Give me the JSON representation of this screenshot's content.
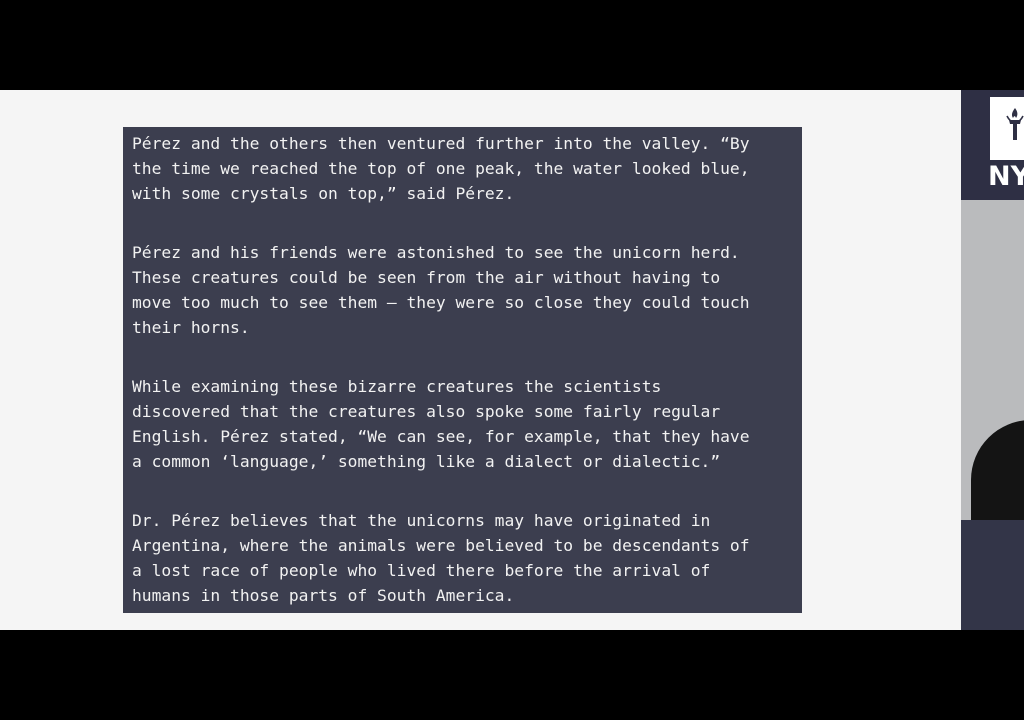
{
  "article": {
    "paragraphs": [
      "Pérez and the others then ventured further into the valley. “By\nthe time we reached the top of one peak, the water looked blue,\nwith some crystals on top,” said Pérez.",
      "Pérez and his friends were astonished to see the unicorn herd.\nThese creatures could be seen from the air without having to\nmove too much to see them – they were so close they could touch\ntheir horns.",
      "While examining these bizarre creatures the scientists\ndiscovered that the creatures also spoke some fairly regular\nEnglish. Pérez stated, “We can see, for example, that they have\na common ‘language,’ something like a dialect or dialectic.”",
      "Dr. Pérez believes that the unicorns may have originated in\nArgentina, where the animals were believed to be descendants of\na lost race of people who lived there before the arrival of\nhumans in those parts of South America."
    ]
  },
  "logo": {
    "text": "NY",
    "icon": "torch-icon"
  },
  "colors": {
    "panel_bg": "#3c3e4f",
    "slide_bg": "#f5f5f5",
    "sidebar_bg": "#2f3144",
    "text": "#f2f2f2"
  }
}
